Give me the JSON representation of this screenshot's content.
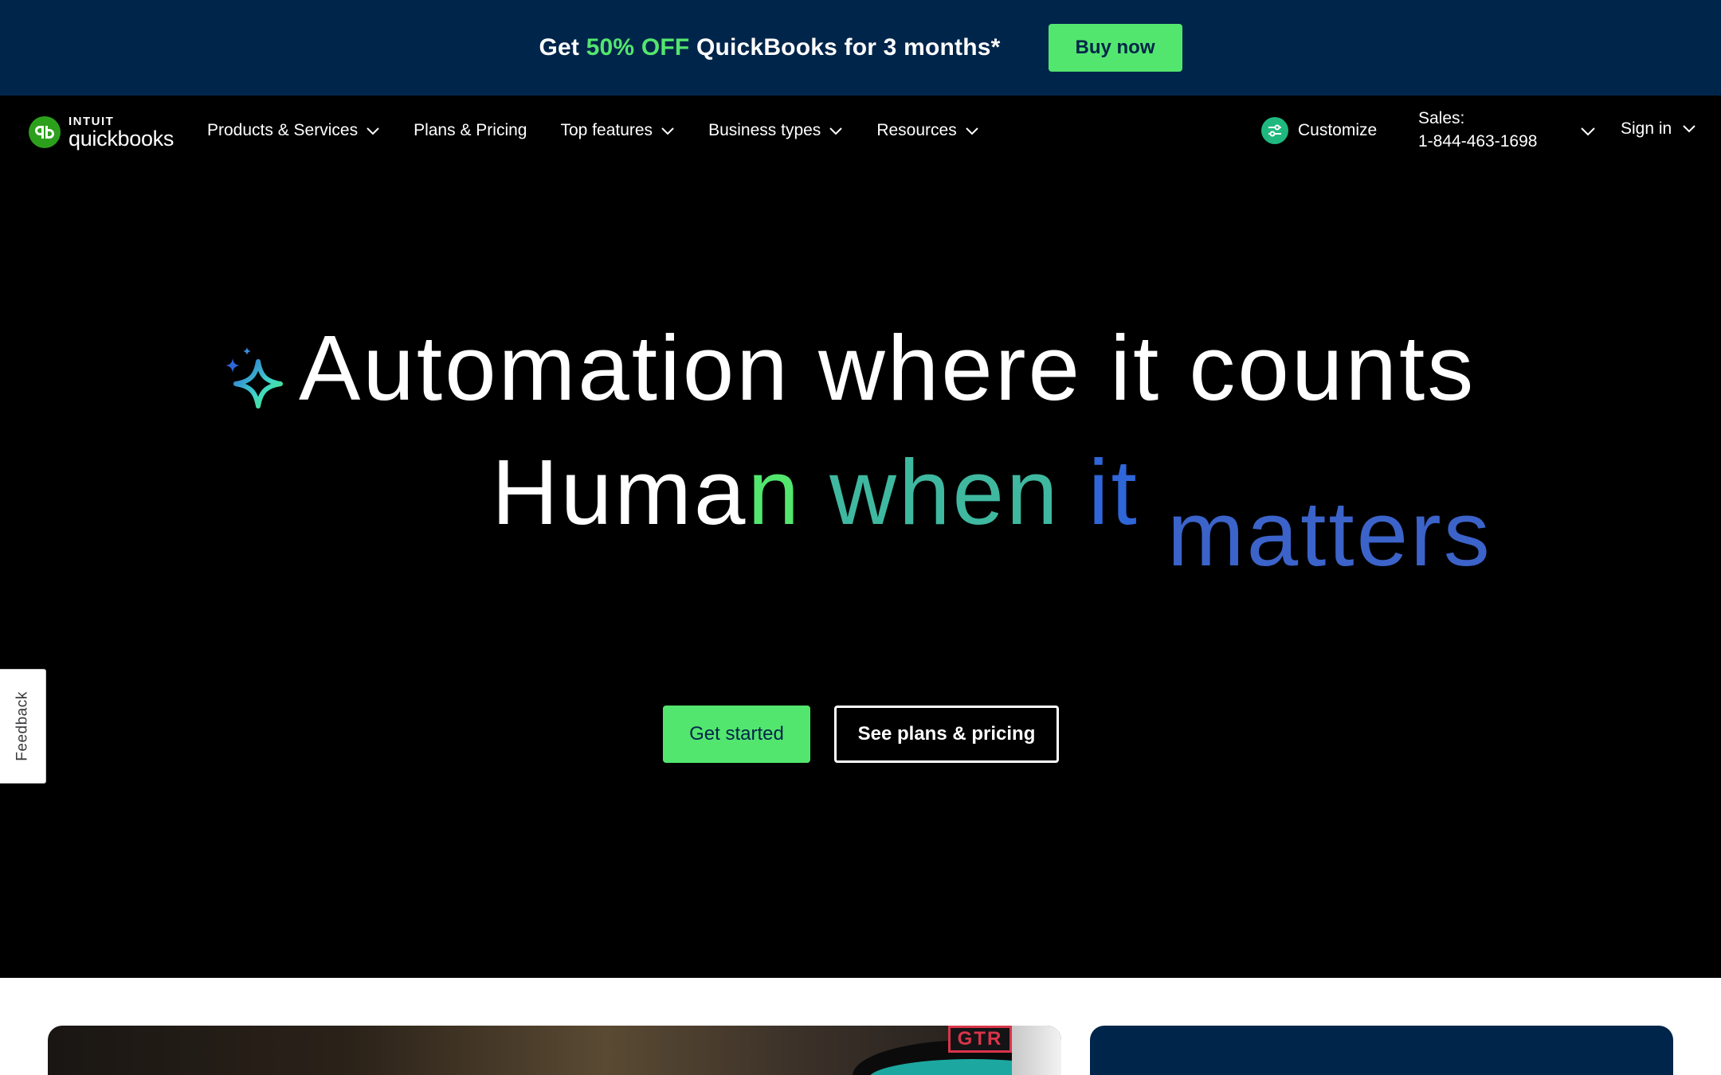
{
  "promo": {
    "text_before": "Get ",
    "text_accent": "50% OFF",
    "text_after": " QuickBooks for 3 months*",
    "button_label": "Buy now"
  },
  "logo": {
    "brand_top": "INTUIT",
    "brand_bottom": "quickbooks"
  },
  "nav": {
    "items": [
      {
        "label": "Products & Services",
        "has_dropdown": true
      },
      {
        "label": "Plans & Pricing",
        "has_dropdown": false
      },
      {
        "label": "Top features",
        "has_dropdown": true
      },
      {
        "label": "Business types",
        "has_dropdown": true
      },
      {
        "label": "Resources",
        "has_dropdown": true
      }
    ],
    "customize_label": "Customize",
    "sales_label": "Sales:",
    "sales_phone": "1-844-463-1698",
    "signin_label": "Sign in"
  },
  "hero": {
    "line1": "Automation where it counts",
    "line2_part1": "Huma",
    "line2_part2": "n",
    "line2_part3": " when",
    "line2_part4": " it",
    "line2_part5": " matters",
    "primary_cta": "Get started",
    "secondary_cta": "See plans & pricing"
  },
  "feedback": {
    "label": "Feedback"
  },
  "cards": {
    "photo_label": "GTR"
  },
  "colors": {
    "promo_bg": "#00254a",
    "accent_green": "#53e66e",
    "hero_bg": "#000000",
    "teal": "#3fb8a0",
    "blue": "#2f66d8",
    "navy_card": "#00254a"
  },
  "icons": {
    "logo": "quickbooks-logo-icon",
    "chevron": "chevron-down-icon",
    "customize": "sliders-icon",
    "sparkle": "ai-sparkle-icon"
  }
}
